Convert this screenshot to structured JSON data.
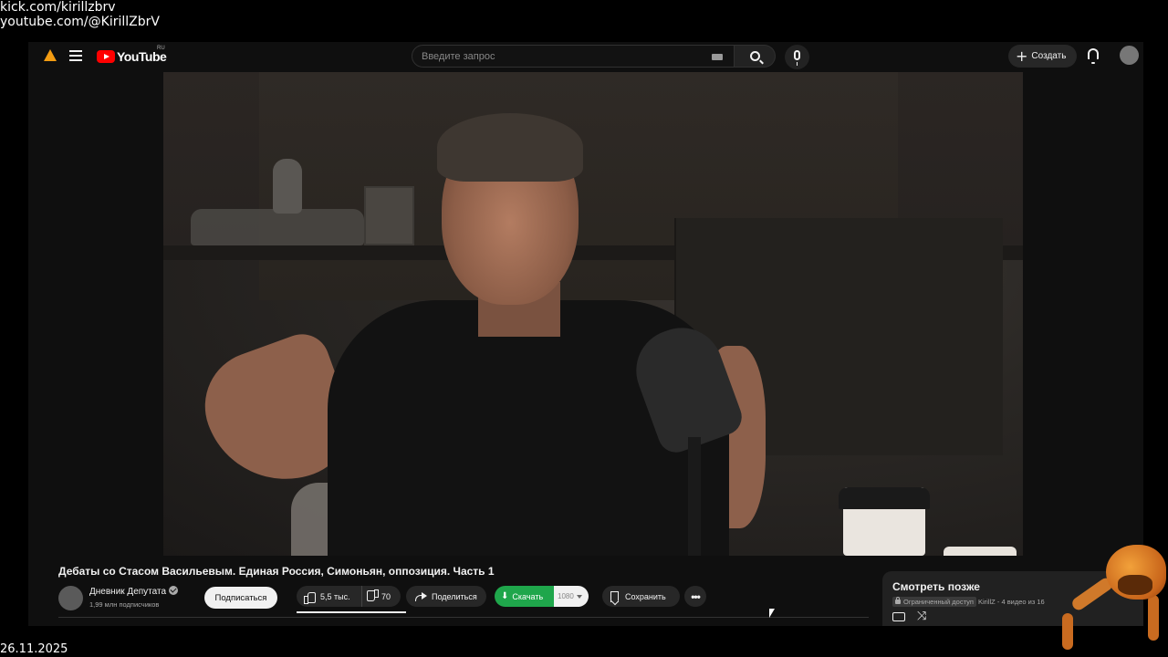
{
  "overlay": {
    "line1": "kick.com/kirillzbrv",
    "line2": "youtube.com/@KirillZbrV",
    "date": "26.11.2025"
  },
  "header": {
    "logo_text": "YouTube",
    "region": "RU",
    "search_placeholder": "Введите запрос",
    "create_label": "Создать",
    "icons": [
      "vlc-icon",
      "menu-icon",
      "keyboard-icon",
      "search-icon",
      "mic-icon",
      "plus-icon",
      "bell-icon",
      "avatar"
    ]
  },
  "video": {
    "title": "Дебаты со Стасом Васильевым. Единая Россия, Симоньян, оппозиция. Часть 1"
  },
  "channel": {
    "name": "Дневник Депутата",
    "subscribers": "1,99 млн подписчиков",
    "subscribe_label": "Подписаться"
  },
  "actions": {
    "likes": "5,5 тыс.",
    "dislikes": "70",
    "share_label": "Поделиться",
    "download_label": "Скачать",
    "download_quality": "1080",
    "save_label": "Сохранить",
    "more_label": "•••"
  },
  "watch_later": {
    "title": "Смотреть позже",
    "access": "Ограниченный доступ",
    "owner": "KirillZ",
    "progress": "4 видео из 16"
  },
  "colors": {
    "background": "#0f0f0f",
    "brand_red": "#ff0000",
    "download_green": "#1fa64b",
    "pill": "#272727"
  }
}
